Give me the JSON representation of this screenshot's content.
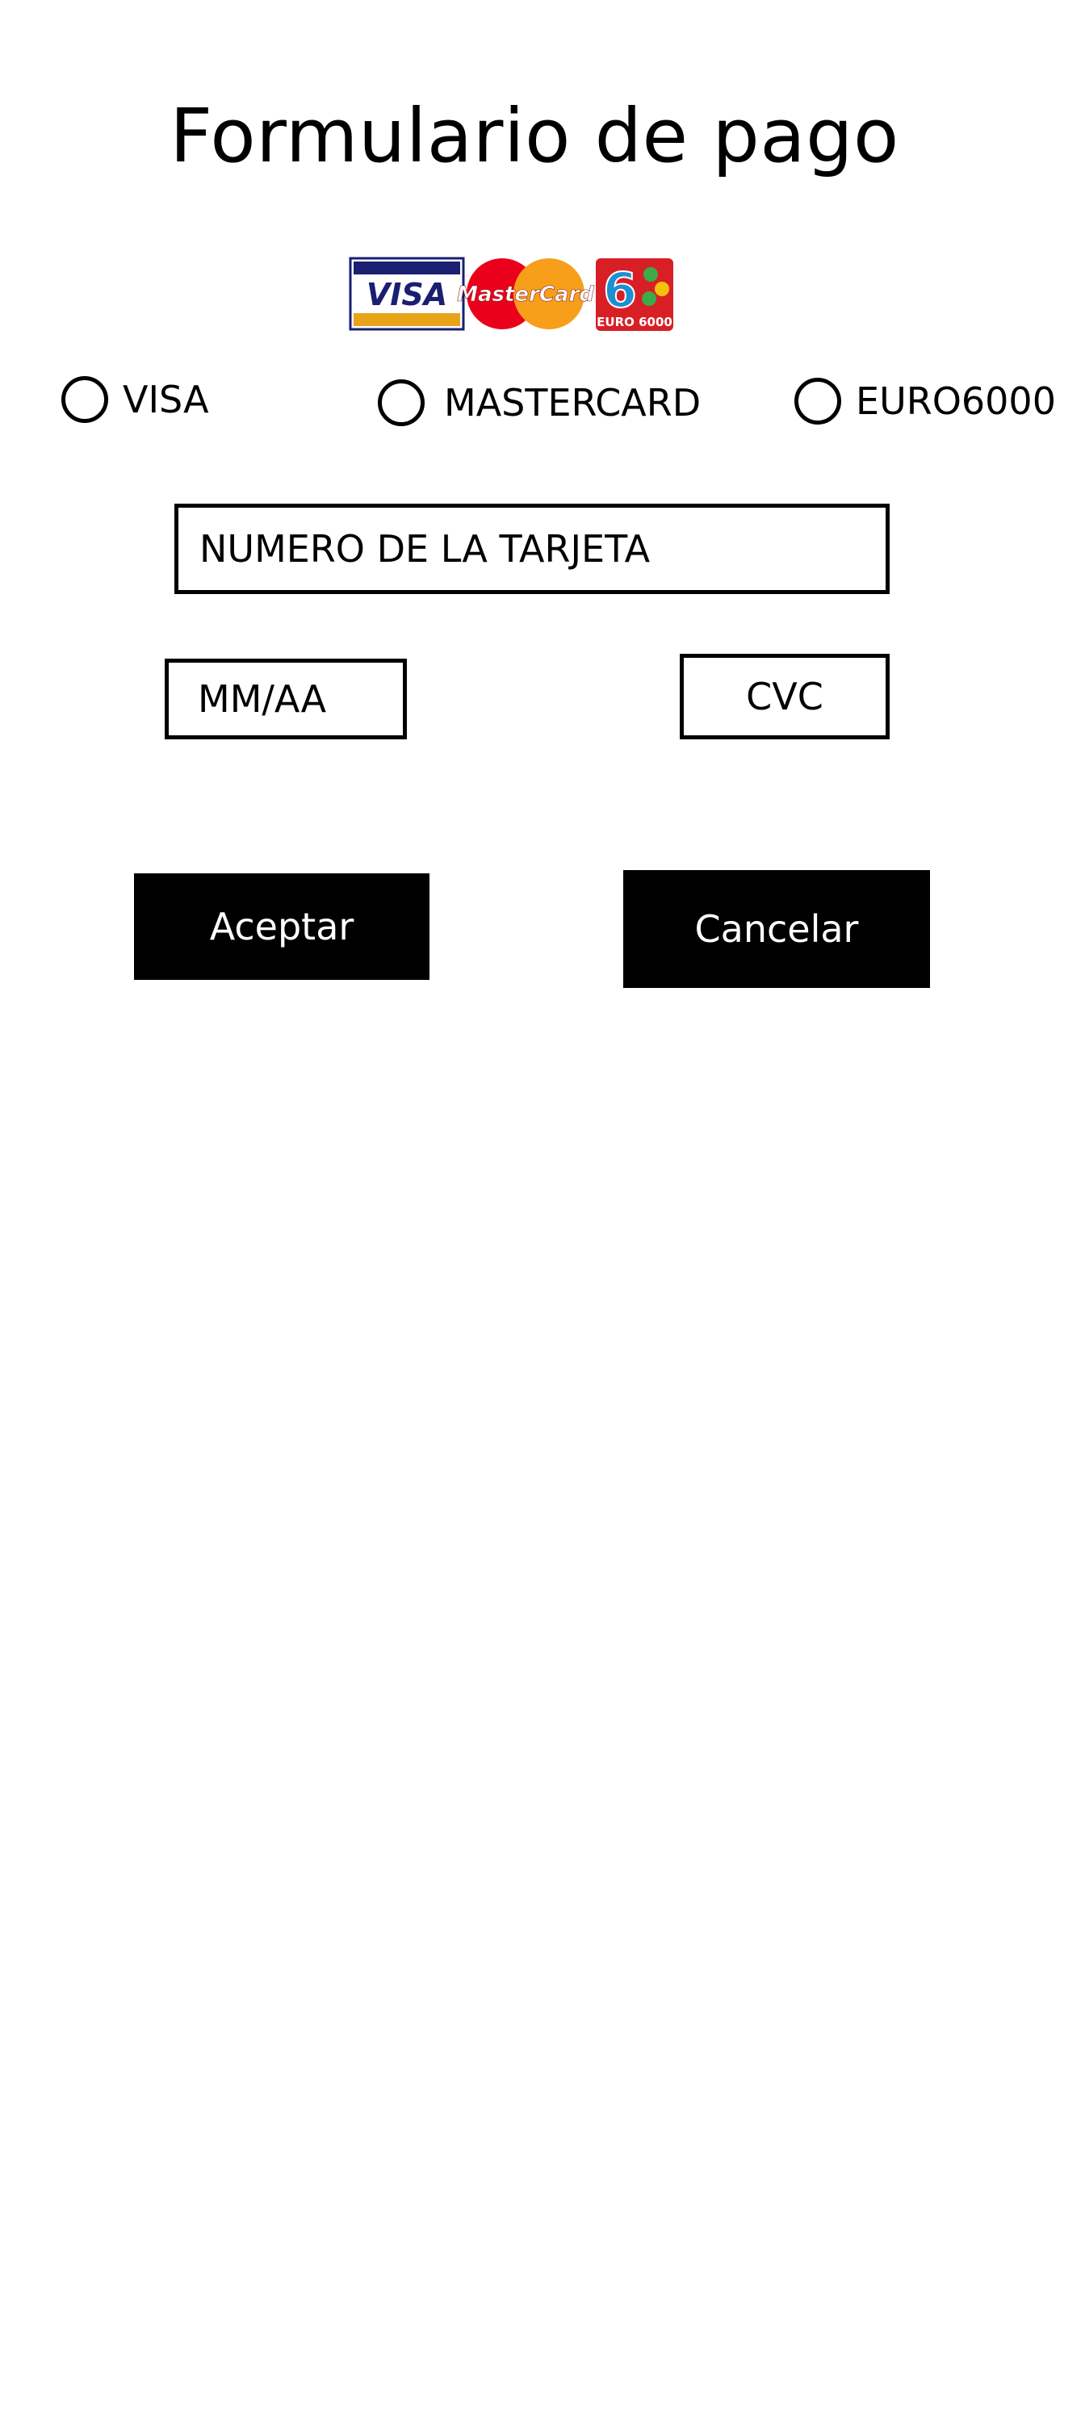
{
  "header": {
    "title": "Formulario de pago"
  },
  "card_logos": {
    "visa_text": "VISA",
    "mastercard_text": "MasterCard",
    "euro6000_text": "EURO 6000",
    "euro6000_numeral": "6",
    "colors": {
      "visa_blue": "#1a1f71",
      "visa_gold": "#e8a419",
      "mastercard_red": "#eb001b",
      "mastercard_orange": "#f79e1b",
      "euro6000_red": "#d81f26",
      "euro6000_blue": "#1f8fd0",
      "euro6000_green": "#3cab48",
      "euro6000_yellow": "#f4c20d"
    }
  },
  "payment_options": [
    {
      "label": "VISA",
      "selected": false
    },
    {
      "label": "MASTERCARD",
      "selected": false
    },
    {
      "label": "EURO6000",
      "selected": false
    }
  ],
  "form": {
    "card_number_placeholder": "NUMERO DE LA TARJETA",
    "expiry_placeholder": "MM/AA",
    "cvc_placeholder": "CVC"
  },
  "actions": {
    "accept_label": "Aceptar",
    "cancel_label": "Cancelar"
  },
  "colors": {
    "background": "#ffffff",
    "foreground": "#000000",
    "button_background": "#000000",
    "button_text": "#ffffff"
  }
}
